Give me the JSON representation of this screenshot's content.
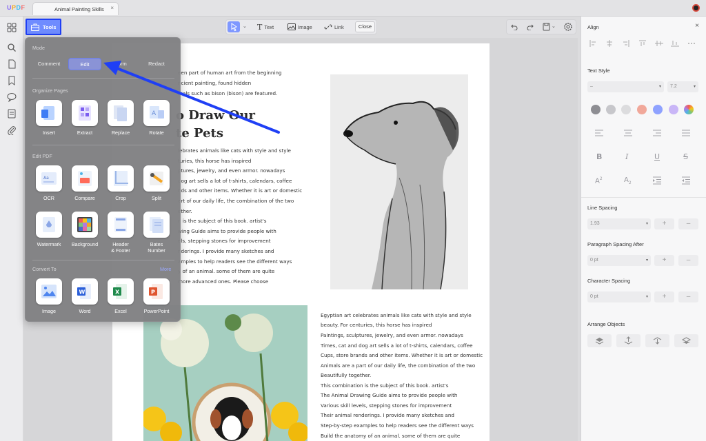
{
  "app": {
    "logo_text": "UPDF",
    "tab_title": "Animal Painting Skills",
    "tab_close": "×"
  },
  "toolbar": {
    "tools_label": "Tools",
    "text_label": "Text",
    "image_label": "Image",
    "link_label": "Link",
    "close_label": "Close"
  },
  "tools_panel": {
    "mode_label": "Mode",
    "modes": [
      "Comment",
      "Edit",
      "Form",
      "Redact"
    ],
    "selected_mode": "Edit",
    "organize_label": "Organize Pages",
    "organize": [
      "Insert",
      "Extract",
      "Replace",
      "Rotate"
    ],
    "edit_pdf_label": "Edit PDF",
    "edit_pdf_row1": [
      "OCR",
      "Compare",
      "Crop",
      "Split"
    ],
    "edit_pdf_row2": [
      "Watermark",
      "Background",
      "Header\n& Footer",
      "Bates\nNumber"
    ],
    "convert_label": "Convert To",
    "more_label": "More",
    "convert": [
      "Image",
      "Word",
      "Excel",
      "PowerPoint"
    ]
  },
  "document": {
    "intro_lines": [
      "een part of human art from the beginning",
      "ncient painting, found hidden",
      "mals such as bison (bison) are featured."
    ],
    "heading_line1": "o Draw Our",
    "heading_line2": "te Pets",
    "left_lines": [
      "lebrates animals like cats with style and style",
      "turies, this horse has inspired",
      "ptures, jewelry, and even armor. nowadays",
      "dog art sells a lot of t-shirts, calendars, coffee",
      "nds and other items. Whether it is art or domestic",
      "art of our daily life, the combination of the two",
      "ether.",
      "n is the subject of this book. artist's",
      "wing Guide aims to provide people with",
      "els, stepping stones for improvement",
      "nderings. I provide many sketches and",
      "amples to help readers see the different ways",
      "y of an animal. some of them are quite",
      "more advanced ones. Please choose"
    ],
    "right_lines": [
      "Egyptian art celebrates animals like cats with style and style",
      "beauty. For centuries, this horse has inspired",
      "Paintings, sculptures, jewelry, and even armor. nowadays",
      "Times, cat and dog art sells a lot of t-shirts, calendars, coffee",
      "Cups, store brands and other items. Whether it is art or domestic",
      "Animals are a part of our daily life, the combination of the two",
      "Beautifully together.",
      "This combination is the subject of this book. artist's",
      "The Animal Drawing Guide aims to provide people with",
      "Various skill levels, stepping stones for improvement",
      "Their animal renderings. I provide many sketches and",
      "Step-by-step examples to help readers see the different ways",
      "Build the anatomy of an animal. some of them are quite"
    ]
  },
  "right_panel": {
    "align_label": "Align",
    "close": "×",
    "text_style_label": "Text Style",
    "font_value": "–",
    "font_size": "7.2",
    "swatches": [
      "#8e8e93",
      "#c7c7cb",
      "#dcdcde",
      "#f1a89a",
      "#8fa2ff",
      "#c9b6f7",
      "#9ad7a8"
    ],
    "line_spacing_label": "Line Spacing",
    "line_spacing_value": "1.93",
    "paragraph_spacing_label": "Paragraph Spacing After",
    "paragraph_spacing_value": "0 pt",
    "character_spacing_label": "Character Spacing",
    "character_spacing_value": "0 pt",
    "arrange_label": "Arrange Objects",
    "plus": "+",
    "minus": "–"
  },
  "colors": {
    "accent": "#1f3ff5",
    "tools_button": "#6f8cff",
    "panel_bg": "#808082"
  }
}
